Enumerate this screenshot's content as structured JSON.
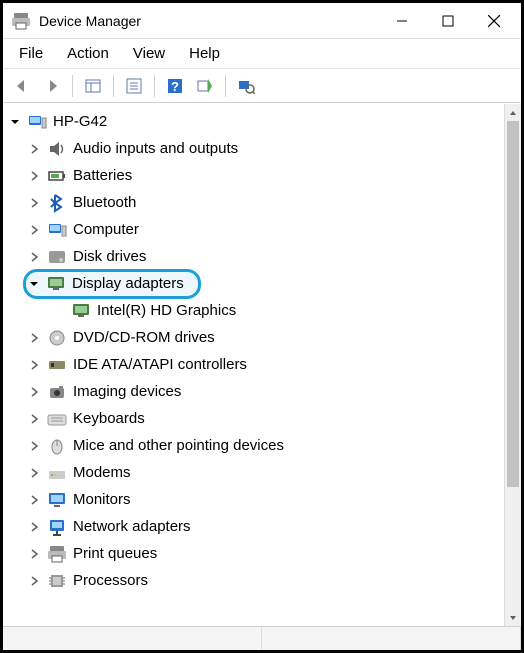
{
  "window": {
    "title": "Device Manager"
  },
  "menu": {
    "file": "File",
    "action": "Action",
    "view": "View",
    "help": "Help"
  },
  "tree": {
    "root": "HP-G42",
    "items": [
      {
        "label": "Audio inputs and outputs",
        "icon": "audio"
      },
      {
        "label": "Batteries",
        "icon": "battery"
      },
      {
        "label": "Bluetooth",
        "icon": "bluetooth"
      },
      {
        "label": "Computer",
        "icon": "computer"
      },
      {
        "label": "Disk drives",
        "icon": "disk"
      },
      {
        "label": "Display adapters",
        "icon": "display",
        "expanded": true,
        "highlighted": true,
        "children": [
          {
            "label": "Intel(R) HD Graphics",
            "icon": "display"
          }
        ]
      },
      {
        "label": "DVD/CD-ROM drives",
        "icon": "dvd"
      },
      {
        "label": "IDE ATA/ATAPI controllers",
        "icon": "ide"
      },
      {
        "label": "Imaging devices",
        "icon": "imaging"
      },
      {
        "label": "Keyboards",
        "icon": "keyboard"
      },
      {
        "label": "Mice and other pointing devices",
        "icon": "mouse"
      },
      {
        "label": "Modems",
        "icon": "modem"
      },
      {
        "label": "Monitors",
        "icon": "monitor"
      },
      {
        "label": "Network adapters",
        "icon": "network"
      },
      {
        "label": "Print queues",
        "icon": "printer"
      },
      {
        "label": "Processors",
        "icon": "cpu"
      }
    ]
  }
}
